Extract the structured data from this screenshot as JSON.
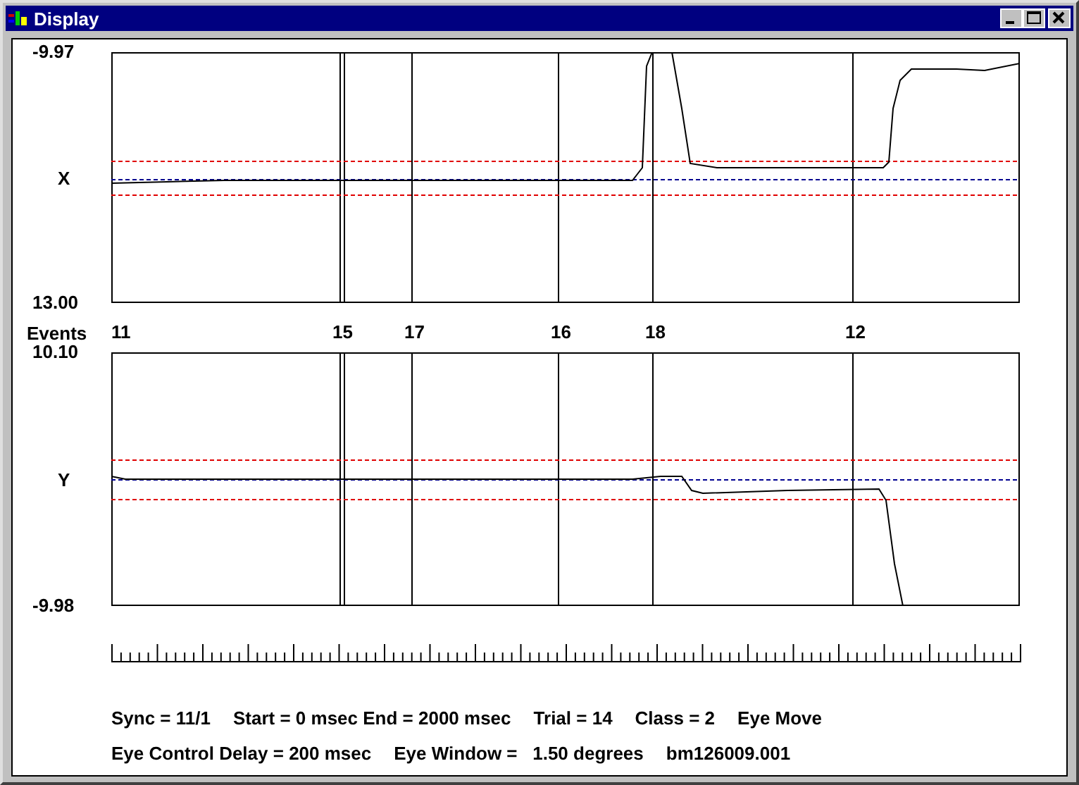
{
  "window": {
    "title": "Display"
  },
  "plots": [
    {
      "axis_label": "X",
      "top_value": "-9.97",
      "bottom_value": "13.00"
    },
    {
      "axis_label": "Y",
      "top_value": "10.10",
      "bottom_value": "-9.98"
    }
  ],
  "events": {
    "label": "Events",
    "markers": [
      "11",
      "15",
      "17",
      "16",
      "18",
      "12"
    ]
  },
  "info_lines": [
    {
      "items": [
        "Sync = 11/1",
        "Start = 0 msec End = 2000 msec",
        "Trial = 14",
        "Class = 2",
        "Eye Move"
      ]
    },
    {
      "items": [
        "Eye Control Delay = 200 msec",
        "Eye Window =   1.50 degrees",
        "bm126009.001"
      ]
    }
  ]
}
